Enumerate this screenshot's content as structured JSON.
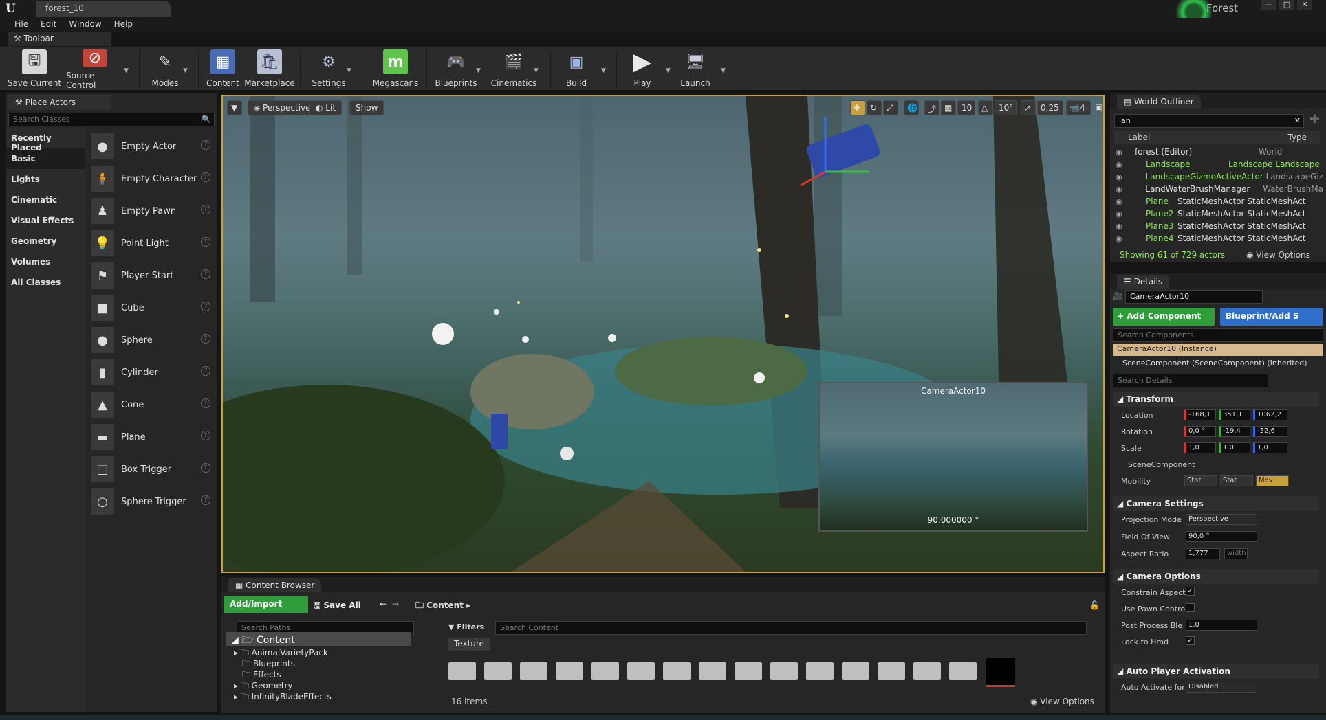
{
  "app": {
    "logo": "U",
    "document_tab": "forest_10",
    "project_name": "Forest",
    "window_buttons": [
      "—",
      "□",
      "✕"
    ]
  },
  "menu": [
    "File",
    "Edit",
    "Window",
    "Help"
  ],
  "toolbar": {
    "tab_label": "Toolbar",
    "buttons": [
      {
        "label": "Save Current",
        "icon": "save-icon"
      },
      {
        "label": "Source Control",
        "icon": "source-control-icon"
      },
      {
        "label": "Modes",
        "icon": "modes-icon"
      },
      {
        "label": "Content",
        "icon": "content-icon"
      },
      {
        "label": "Marketplace",
        "icon": "marketplace-icon"
      },
      {
        "label": "Settings",
        "icon": "settings-icon"
      },
      {
        "label": "Megascans",
        "icon": "megascans-icon"
      },
      {
        "label": "Blueprints",
        "icon": "blueprints-icon"
      },
      {
        "label": "Cinematics",
        "icon": "cinematics-icon"
      },
      {
        "label": "Build",
        "icon": "build-icon"
      },
      {
        "label": "Play",
        "icon": "play-icon"
      },
      {
        "label": "Launch",
        "icon": "launch-icon"
      }
    ]
  },
  "place_actors": {
    "tab_label": "Place Actors",
    "search_placeholder": "Search Classes",
    "categories": [
      "Recently Placed",
      "Basic",
      "Lights",
      "Cinematic",
      "Visual Effects",
      "Geometry",
      "Volumes",
      "All Classes"
    ],
    "selected_category": "Basic",
    "actors": [
      "Empty Actor",
      "Empty Character",
      "Empty Pawn",
      "Point Light",
      "Player Start",
      "Cube",
      "Sphere",
      "Cylinder",
      "Cone",
      "Plane",
      "Box Trigger",
      "Sphere Trigger"
    ]
  },
  "viewport": {
    "view_mode": "Perspective",
    "lighting": "Lit",
    "show": "Show",
    "grid_snap": "10",
    "rot_snap": "10°",
    "scale_snap": "0,25",
    "camera_speed": "4",
    "pip_title": "CameraActor10",
    "pip_fov": "90.000000 °"
  },
  "outliner": {
    "tab_label": "World Outliner",
    "search_value": "lan",
    "col_label": "Label",
    "col_type": "Type",
    "rows": [
      {
        "label": "forest (Editor)",
        "type": "World"
      },
      {
        "label": "Landscape",
        "type": "Landscape Landscape"
      },
      {
        "label": "LandscapeGizmoActiveActor",
        "type": "LandscapeGiz"
      },
      {
        "label": "LandWaterBrushManager",
        "type": "WaterBrushMa"
      },
      {
        "label": "Plane",
        "type": "StaticMeshActor StaticMeshAct"
      },
      {
        "label": "Plane2",
        "type": "StaticMeshActor StaticMeshAct"
      },
      {
        "label": "Plane3",
        "type": "StaticMeshActor StaticMeshAct"
      },
      {
        "label": "Plane4",
        "type": "StaticMeshActor StaticMeshAct"
      }
    ],
    "status": "Showing 61 of 729 actors",
    "view_options": "View Options"
  },
  "details": {
    "tab_label": "Details",
    "actor_name": "CameraActor10",
    "add_component": "+ Add Component",
    "blueprint": "Blueprint/Add S",
    "search_components": "Search Components",
    "instance_row": "CameraActor10 (Instance)",
    "scene_component_row": "SceneComponent (SceneComponent) (Inherited)",
    "search_details": "Search Details",
    "transform": {
      "title": "Transform",
      "location_label": "Location",
      "location": [
        "-168,1",
        "351,1",
        "1062,2"
      ],
      "rotation_label": "Rotation",
      "rotation": [
        "0,0 °",
        "-19,4",
        "-32,6"
      ],
      "scale_label": "Scale",
      "scale": [
        "1,0",
        "1,0",
        "1,0"
      ],
      "scene_component": "SceneComponent",
      "mobility_label": "Mobility",
      "mobility": [
        "Stat",
        "Stat",
        "Mov"
      ]
    },
    "camera_settings": {
      "title": "Camera Settings",
      "projection_label": "Projection Mode",
      "projection": "Perspective",
      "fov_label": "Field Of View",
      "fov": "90,0 °",
      "aspect_label": "Aspect Ratio",
      "aspect": "1,777",
      "aspect_unit": "width"
    },
    "camera_options": {
      "title": "Camera Options",
      "constrain": "Constrain Aspect",
      "pawn_control": "Use Pawn Control",
      "post_process": "Post Process Ble",
      "post_process_value": "1,0",
      "lock_hmd": "Lock to Hmd"
    },
    "auto_player": {
      "title": "Auto Player Activation",
      "activate_label": "Auto Activate for",
      "activate_value": "Disabled"
    }
  },
  "content_browser": {
    "tab_label": "Content Browser",
    "add_import": "Add/Import",
    "save_all": "Save All",
    "path": "Content",
    "search_paths": "Search Paths",
    "filters": "Filters",
    "search_content": "Search Content",
    "filter_chip": "Texture",
    "tree_root": "Content",
    "tree": [
      "AnimalVarietyPack",
      "Blueprints",
      "Effects",
      "Geometry",
      "InfinityBladeEffects"
    ],
    "item_count": "16 items",
    "view_options": "View Options"
  }
}
